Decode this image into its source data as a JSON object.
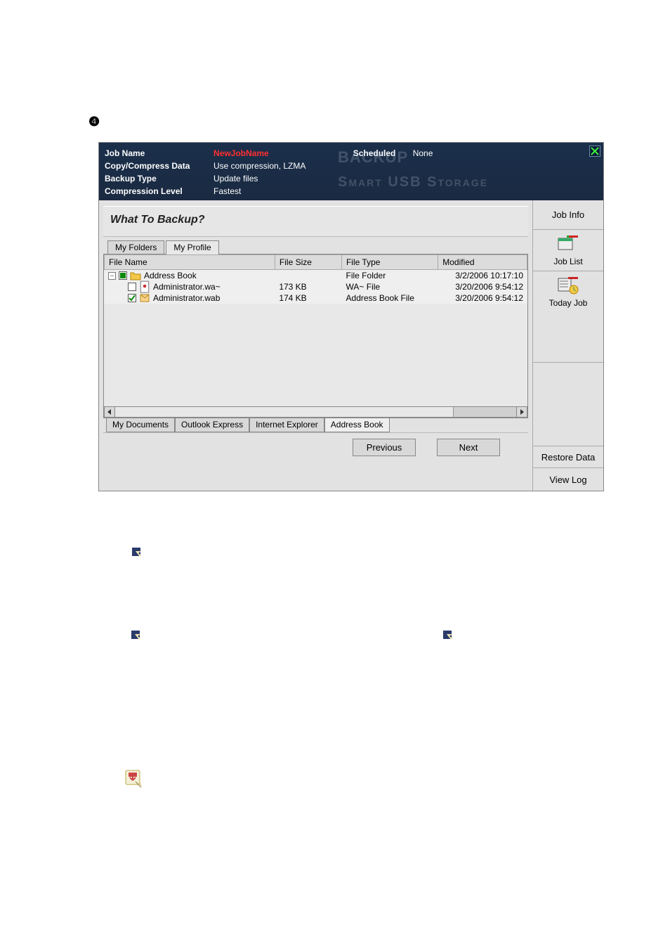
{
  "step_marker": "❹",
  "header": {
    "job_name_label": "Job Name",
    "job_name_value": "NewJobName",
    "copy_compress_label": "Copy/Compress Data",
    "copy_compress_value": "Use compression, LZMA",
    "backup_type_label": "Backup Type",
    "backup_type_value": "Update files",
    "compression_level_label": "Compression Level",
    "compression_level_value": "Fastest",
    "scheduled_label": "Scheduled",
    "scheduled_value": "None",
    "brand1": "BACKUP",
    "brand2": "Smart USB Storage"
  },
  "main": {
    "section_title": "What To Backup?",
    "tabs_top": [
      "My Folders",
      "My Profile"
    ],
    "active_top_tab": 1,
    "columns": [
      "File Name",
      "File Size",
      "File Type",
      "Modified"
    ],
    "rows": [
      {
        "indent": 0,
        "expander": "-",
        "check": "partial",
        "icon": "folder",
        "name": "Address Book",
        "size": "",
        "type": "File Folder",
        "modified": "3/2/2006 10:17:10"
      },
      {
        "indent": 1,
        "expander": "",
        "check": "none",
        "icon": "file",
        "name": "Administrator.wa~",
        "size": "173 KB",
        "type": "WA~ File",
        "modified": "3/20/2006 9:54:12"
      },
      {
        "indent": 1,
        "expander": "",
        "check": "checked",
        "icon": "wab",
        "name": "Administrator.wab",
        "size": "174 KB",
        "type": "Address Book File",
        "modified": "3/20/2006 9:54:12"
      }
    ],
    "tabs_bottom": [
      "My Documents",
      "Outlook Express",
      "Internet Explorer",
      "Address Book"
    ],
    "active_bottom_tab": 3,
    "prev_label": "Previous",
    "next_label": "Next"
  },
  "side": {
    "title": "Job Info",
    "items": [
      {
        "label": "Job List",
        "icon": "job-list"
      },
      {
        "label": "Today Job",
        "icon": "today-job"
      }
    ],
    "restore": "Restore Data",
    "viewlog": "View Log"
  }
}
